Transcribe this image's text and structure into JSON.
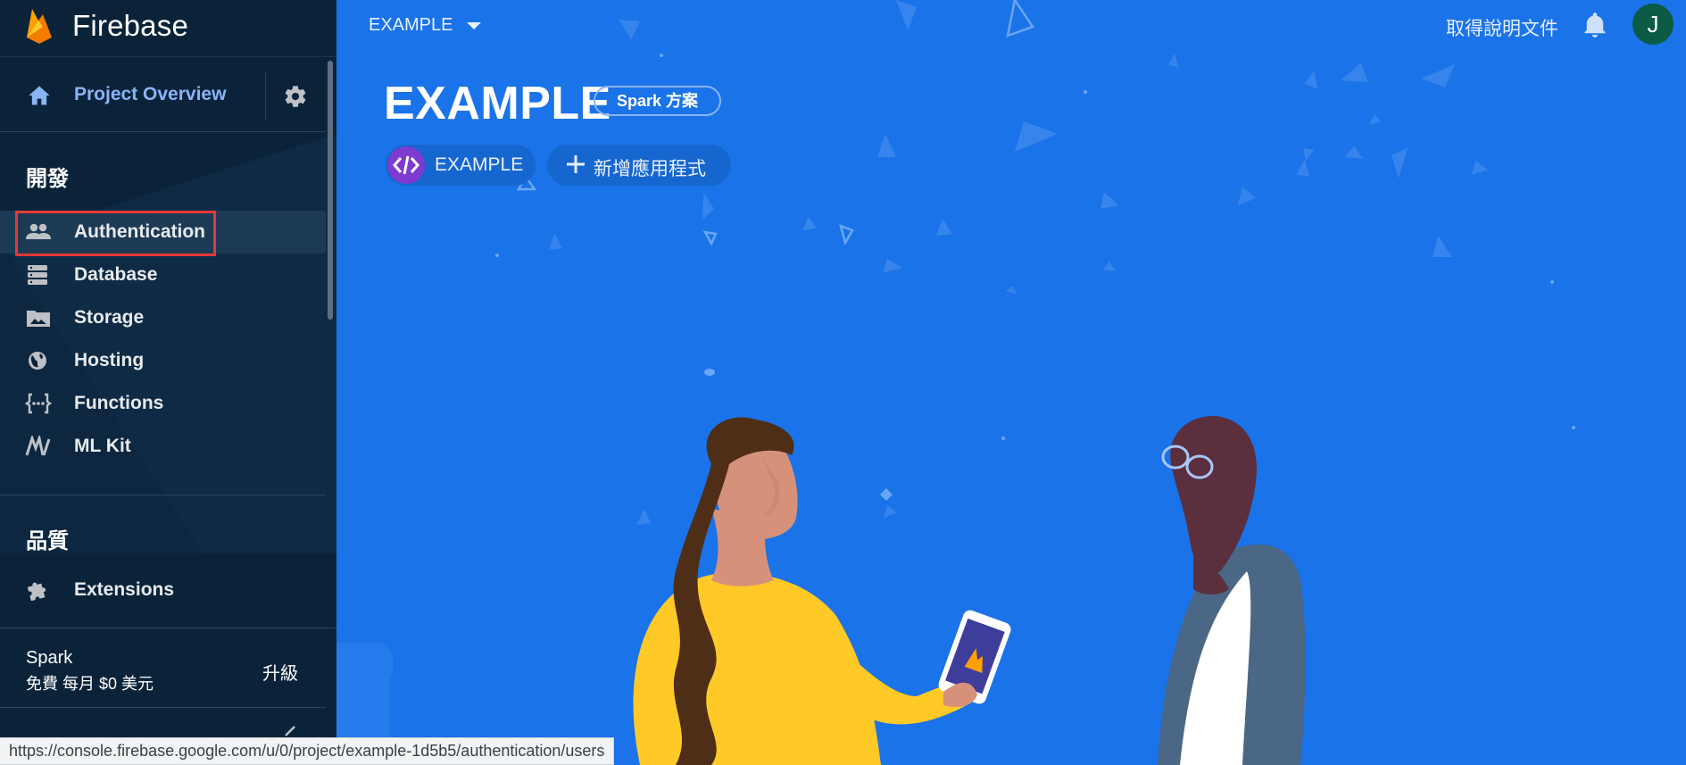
{
  "sidebar": {
    "brand_name": "Firebase",
    "overview_label": "Project Overview",
    "sections": [
      {
        "title": "開發",
        "items": [
          {
            "label": "Authentication",
            "icon": "people-icon"
          },
          {
            "label": "Database",
            "icon": "database-icon"
          },
          {
            "label": "Storage",
            "icon": "folder-image-icon"
          },
          {
            "label": "Hosting",
            "icon": "globe-icon"
          },
          {
            "label": "Functions",
            "icon": "functions-icon"
          },
          {
            "label": "ML Kit",
            "icon": "ml-kit-icon"
          }
        ]
      },
      {
        "title": "品質",
        "items": []
      }
    ],
    "extensions_label": "Extensions",
    "plan": {
      "name": "Spark",
      "price": "免費 每月 $0 美元",
      "upgrade_label": "升級"
    }
  },
  "topbar": {
    "project_selector": "EXAMPLE",
    "docs_link": "取得說明文件",
    "avatar_letter": "J"
  },
  "main": {
    "project_title": "EXAMPLE",
    "plan_chip": "Spark 方案",
    "app_chip_label": "EXAMPLE",
    "add_app_label": "新增應用程式"
  },
  "status_url": "https://console.firebase.google.com/u/0/project/example-1d5b5/authentication/users",
  "colors": {
    "sidebar_bg": "#0b2339",
    "main_bg": "#1a73e8",
    "accent_link": "#8ab4f8",
    "highlight_box": "#e53935",
    "avatar_bg": "#0b5b46",
    "app_badge": "#7e3ad1"
  }
}
